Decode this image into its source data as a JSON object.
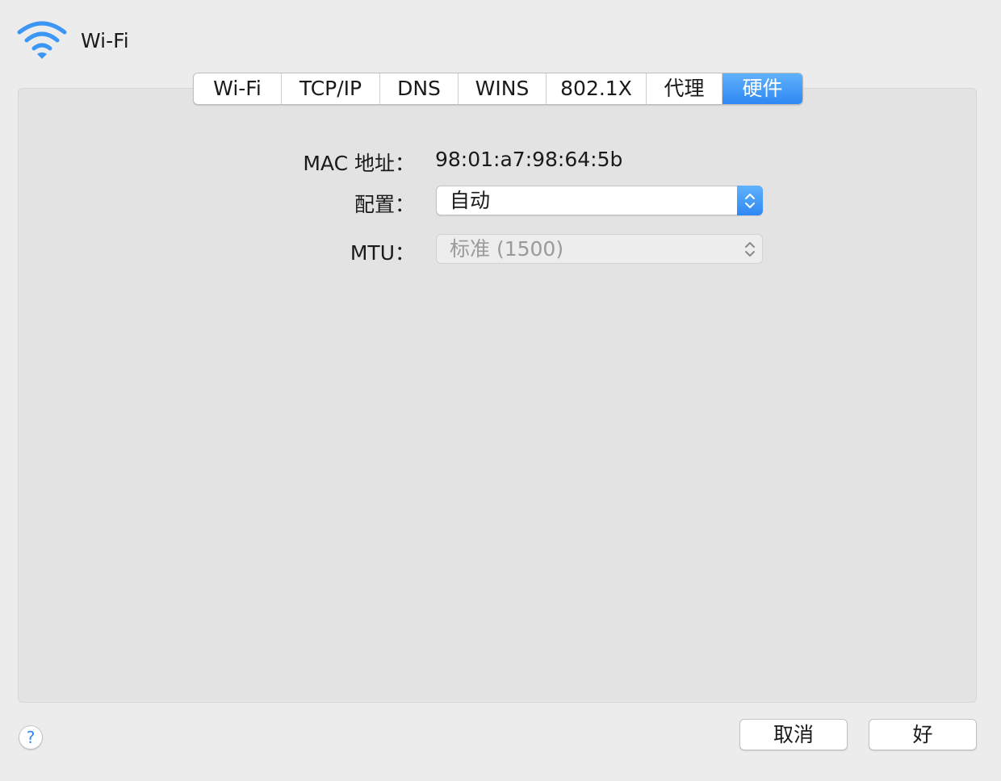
{
  "header": {
    "title": "Wi-Fi",
    "icon": "wifi-icon"
  },
  "tabs": [
    {
      "label": "Wi-Fi",
      "active": false
    },
    {
      "label": "TCP/IP",
      "active": false
    },
    {
      "label": "DNS",
      "active": false
    },
    {
      "label": "WINS",
      "active": false
    },
    {
      "label": "802.1X",
      "active": false
    },
    {
      "label": "代理",
      "active": false
    },
    {
      "label": "硬件",
      "active": true
    }
  ],
  "hardware": {
    "mac_label": "MAC 地址：",
    "mac_value": "98:01:a7:98:64:5b",
    "config_label": "配置：",
    "config_value": "自动",
    "mtu_label": "MTU：",
    "mtu_value": "标准 (1500)"
  },
  "footer": {
    "help_label": "?",
    "cancel_label": "取消",
    "ok_label": "好"
  },
  "colors": {
    "accent": "#2f88f4",
    "accent_light": "#5fb2fb",
    "window_bg": "#ececec",
    "panel_bg": "#e3e3e3"
  }
}
